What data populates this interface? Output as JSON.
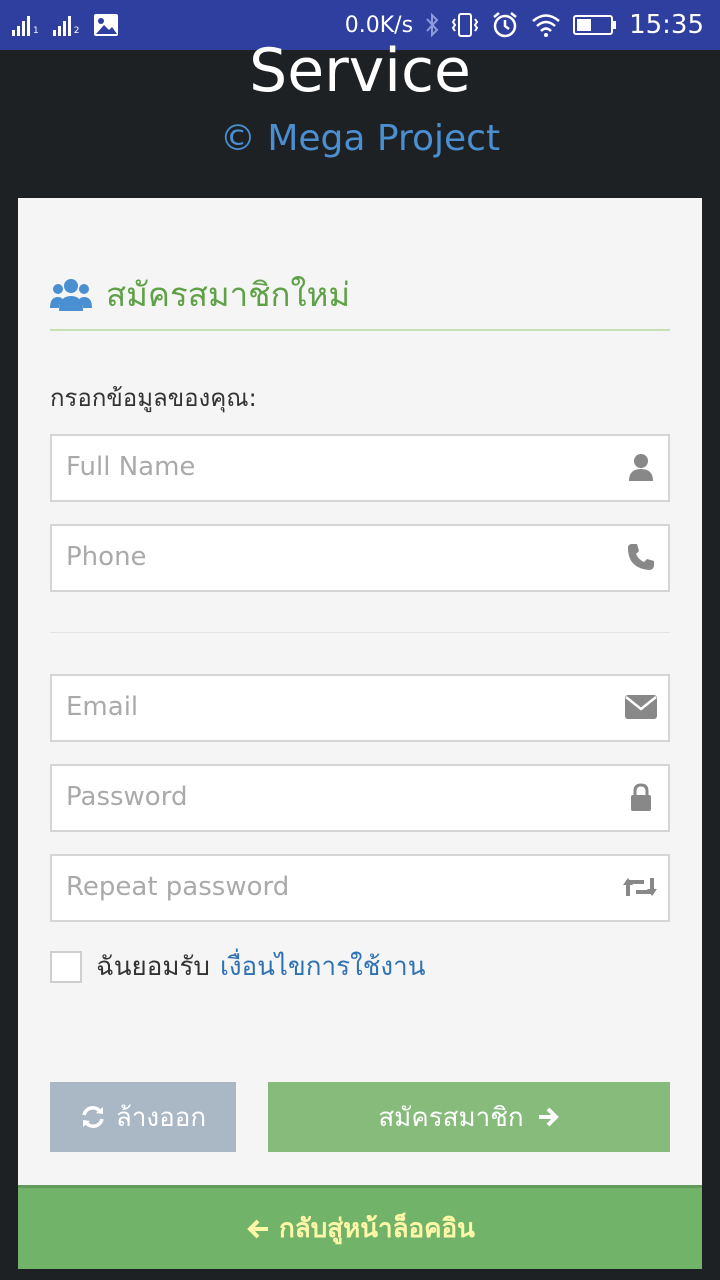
{
  "status_bar": {
    "sim1": "1",
    "sim2": "2",
    "net_speed": "0.0K/s",
    "time": "15:35"
  },
  "app": {
    "title": "Service",
    "subtitle": "© Mega Project"
  },
  "form": {
    "heading": "สมัครสมาชิกใหม่",
    "prompt": "กรอกข้อมูลของคุณ:",
    "fields": {
      "full_name": {
        "placeholder": "Full Name",
        "icon": "user-icon"
      },
      "phone": {
        "placeholder": "Phone",
        "icon": "phone-icon"
      },
      "email": {
        "placeholder": "Email",
        "icon": "envelope-icon"
      },
      "password": {
        "placeholder": "Password",
        "icon": "lock-icon"
      },
      "repeat_password": {
        "placeholder": "Repeat password",
        "icon": "retweet-icon"
      }
    },
    "terms": {
      "text": "ฉันยอมรับ",
      "link": "เงื่อนไขการใช้งาน",
      "checked": false
    },
    "reset_label": "ล้างออก",
    "submit_label": "สมัครสมาชิก",
    "back_label": "กลับสู่หน้าล็อคอิน"
  },
  "colors": {
    "status_bar": "#2f3fa0",
    "background": "#1e2124",
    "heading_green": "#5ea147",
    "subtitle_blue": "#4a8fd1",
    "reset_button": "#a9b8c4",
    "submit_button": "#86bb7b",
    "back_bar": "#72b36a",
    "back_text": "#fff7a8"
  }
}
